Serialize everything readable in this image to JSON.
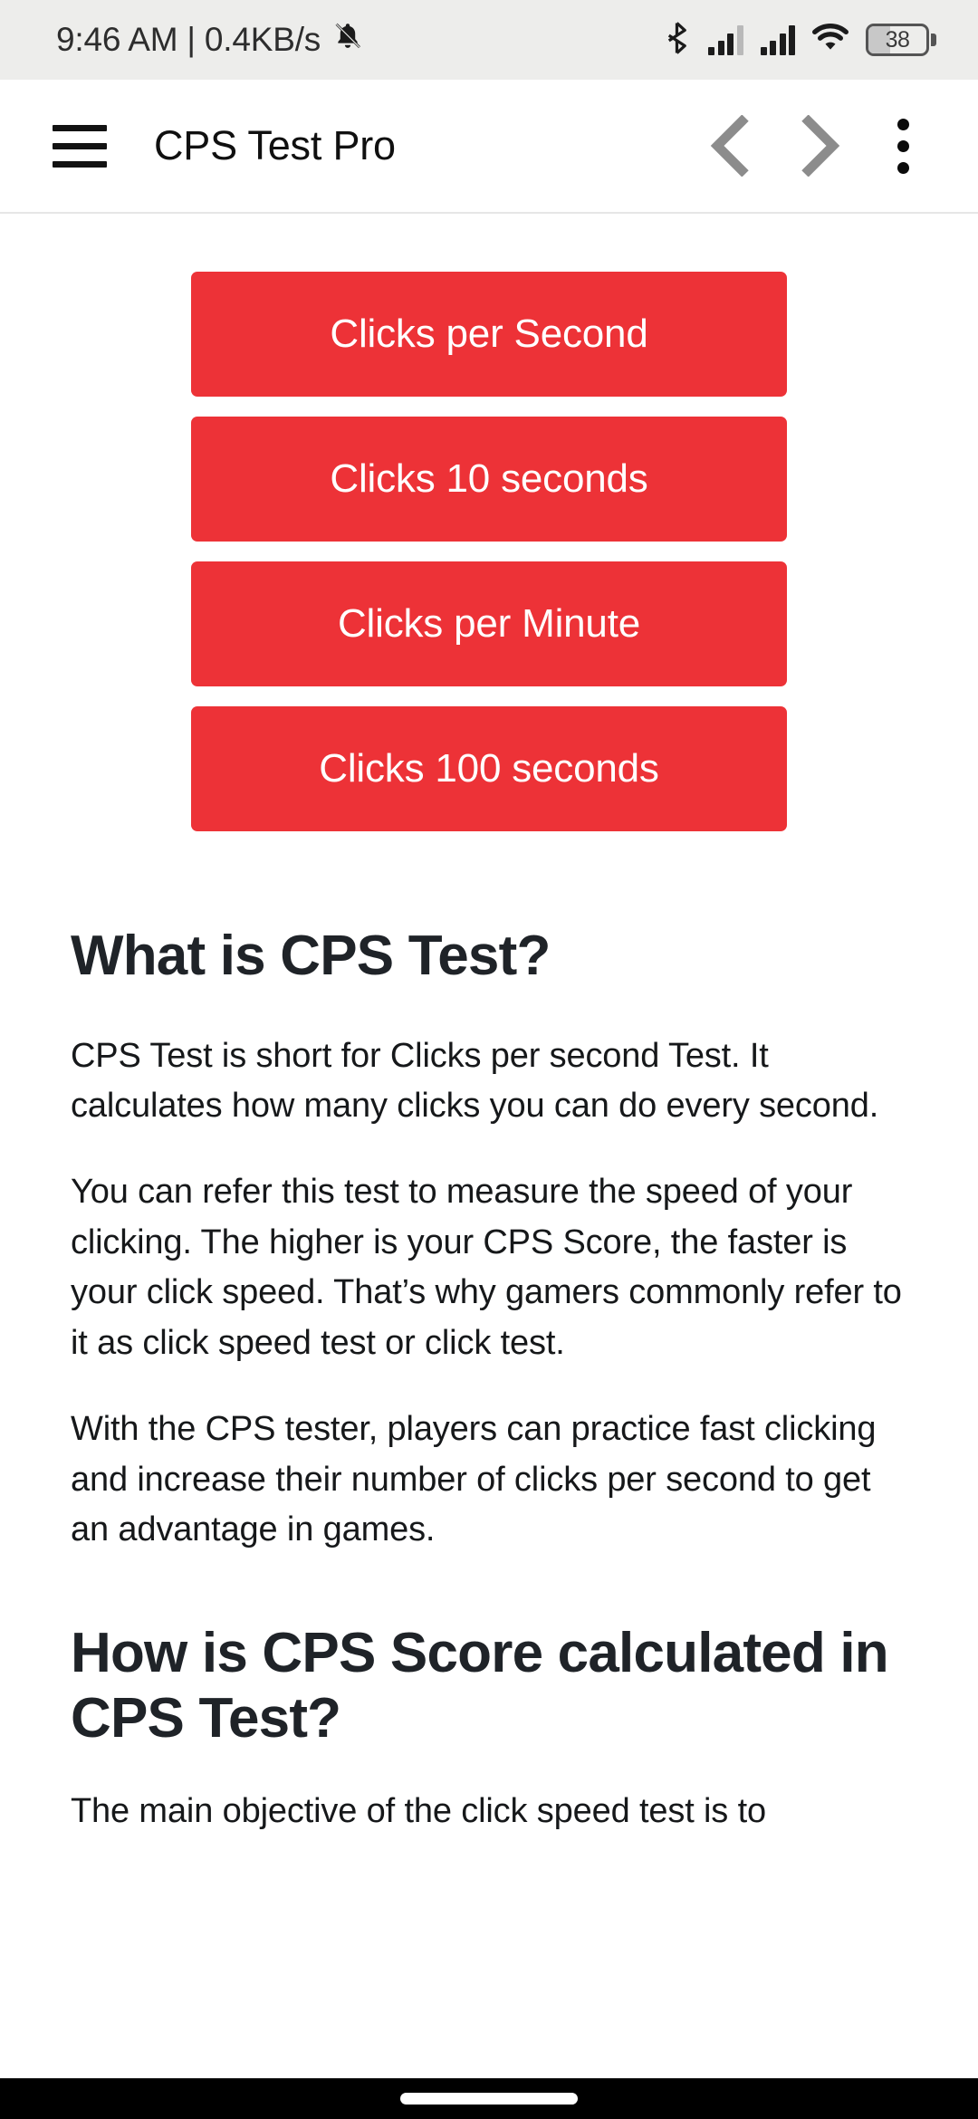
{
  "status_bar": {
    "clock": "9:46 AM | 0.4KB/s",
    "notification_icon": "bell-mute-icon",
    "bluetooth_icon": "bluetooth-icon",
    "signal_1_icon": "cellular-signal-icon",
    "signal_2_icon": "cellular-signal-icon",
    "wifi_icon": "wifi-icon",
    "battery_percent": "38",
    "background_color": "#ededeb"
  },
  "app_bar": {
    "menu_icon": "hamburger-menu-icon",
    "title": "CPS Test Pro",
    "back_icon": "chevron-left-icon",
    "forward_icon": "chevron-right-icon",
    "overflow_icon": "more-vertical-icon",
    "icon_inactive_color": "#8c8c8c"
  },
  "main": {
    "accent_color": "#ed3237",
    "buttons": [
      {
        "label": "Clicks per Second"
      },
      {
        "label": "Clicks 10 seconds"
      },
      {
        "label": "Clicks per Minute"
      },
      {
        "label": "Clicks 100 seconds"
      }
    ],
    "heading_1": "What is CPS Test?",
    "paragraph_1": "CPS Test is short for Clicks per second Test. It calculates how many clicks you can do every second.",
    "paragraph_2": "You can refer this test to measure the speed of your clicking. The higher is your CPS Score, the faster is your click speed. That’s why gamers commonly refer to it as click speed test or click test.",
    "paragraph_3": "With the CPS tester, players can practice fast clicking and increase their number of clicks per second to get an advantage in games.",
    "heading_2": "How is CPS Score calculated in CPS Test?",
    "paragraph_4": "The main objective of the click speed test is to"
  },
  "nav_bar": {
    "gesture_pill": "gesture-home-pill"
  }
}
